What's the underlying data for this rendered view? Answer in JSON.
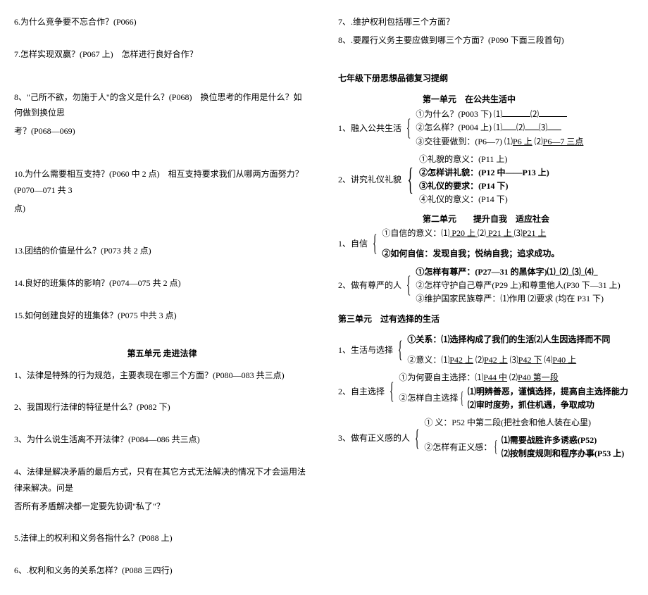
{
  "left": {
    "q6": "6.为什么竞争要不忘合作？(P066)",
    "q7": "7.怎样实现双赢？(P067 上)　怎样进行良好合作？",
    "q8a": "8、\"己所不欲，勿施于人\"的含义是什么？(P068)　换位思考的作用是什么？如何做到换位思",
    "q8b": "考？(P068—069)",
    "q10a": "10.为什么需要相互支持？(P060 中 2 点)　相互支持要求我们从哪两方面努力？(P070—071 共 3",
    "q10b": "点)",
    "q13": "13.团结的价值是什么？(P073 共 2 点)",
    "q14": "14.良好的班集体的影响？(P074—075 共 2 点)",
    "q15": "15.如何创建良好的班集体？(P075 中共 3 点)",
    "unit5_title": "第五单元 走进法律",
    "l1": "1、法律是特殊的行为规范，主要表现在哪三个方面？(P080—083 共三点)",
    "l2": "2、我国现行法律的特征是什么？(P082 下)",
    "l3": "3、为什么说生活离不开法律？(P084—086 共三点)",
    "l4a": "4、法律是解决矛盾的最后方式，只有在其它方式无法解决的情况下才会运用法律来解决。问是",
    "l4b": "否所有矛盾解决都一定要先协调\"私了\"？",
    "l5": "5.法律上的权利和义务各指什么？(P088 上)",
    "l6": "6、.权利和义务的关系怎样？(P088 三四行)"
  },
  "right": {
    "q7": "7、.维护权利包括哪三个方面？",
    "q8": "8、.要履行义务主要应做到哪三个方面？(P090 下面三段首句)",
    "outline_title": "七年级下册思想品德复习提纲",
    "unit1_title": "第一单元　在公共生活中",
    "item1_label": "1、融入公共生活",
    "item1_1a": "①为什么？(P003 下) ⑴",
    "item1_1b": "⑵",
    "item1_2a": "②怎么样？(P004 上) ⑴",
    "item1_2b": "⑵",
    "item1_2c": "⑶",
    "item1_3a": "③交往要做到：(P6—7) ⑴",
    "item1_3b": "P6 上",
    "item1_3c": " ⑵",
    "item1_3d": "P6—7 三点",
    "item2_label": "2、讲究礼仪礼貌",
    "item2_1": "①礼貌的意义：(P11 上)",
    "item2_2": "②怎样讲礼貌：(P12 中——P13 上)",
    "item2_3": "③礼仪的要求：(P14 下)",
    "item2_4": "④礼仪的意义：(P14 下)",
    "unit2_title": "第二单元　　提升自我　适应社会",
    "item3_label": "1、自信",
    "item3_1a": "①自信的意义：⑴",
    "item3_1b": " P20 上 ",
    "item3_1c": " ⑵",
    "item3_1d": " P21 上 ",
    "item3_1e": " ⑶",
    "item3_1f": "P21 上",
    "item3_2": "②如何自信：发现自我；悦纳自我；追求成功。",
    "item4_label": "2、做有尊严的人",
    "item4_1": "①怎样有尊严：(P27—31 的黑体字)⑴_⑵_⑶_⑷_",
    "item4_2": "②怎样守护自己尊严(P29 上)和尊重他人(P30 下—31 上)",
    "item4_3": "③维护国家民族尊严：⑴作用 ⑵要求 (均在 P31 下)",
    "unit3_title": "第三单元　过有选择的生活",
    "item5_label": "1、生活与选择",
    "item5_1": "①关系：⑴选择构成了我们的生活⑵人生因选择而不同",
    "item5_2": "②意义：⑴",
    "item5_2a": "P42 上",
    "item5_2b": " ⑵",
    "item5_2c": "P42 上",
    "item5_2d": " ⑶",
    "item5_2e": "P42 下",
    "item5_2f": " ⑷",
    "item5_2g": "P40 上",
    "item6_label": "2、自主选择",
    "item6_1a": "①为何要自主选择：⑴",
    "item6_1b": "P44 中",
    "item6_1c": " ⑵",
    "item6_1d": "P40 第一段",
    "item6_2_label": "②怎样自主选择",
    "item6_2_1": "⑴明辨善恶，谨慎选择，提高自主选择能力",
    "item6_2_2": "⑵审时度势，抓住机遇，争取成功",
    "item7_label": "3、做有正义感的人",
    "item7_1": "① 义：P52 中第二段(把社会和他人装在心里)",
    "item7_2_label": "②怎样有正义感：",
    "item7_2_1": "⑴需要战胜许多诱惑(P52)",
    "item7_2_2": "⑵按制度规则和程序办事(P53 上)"
  }
}
